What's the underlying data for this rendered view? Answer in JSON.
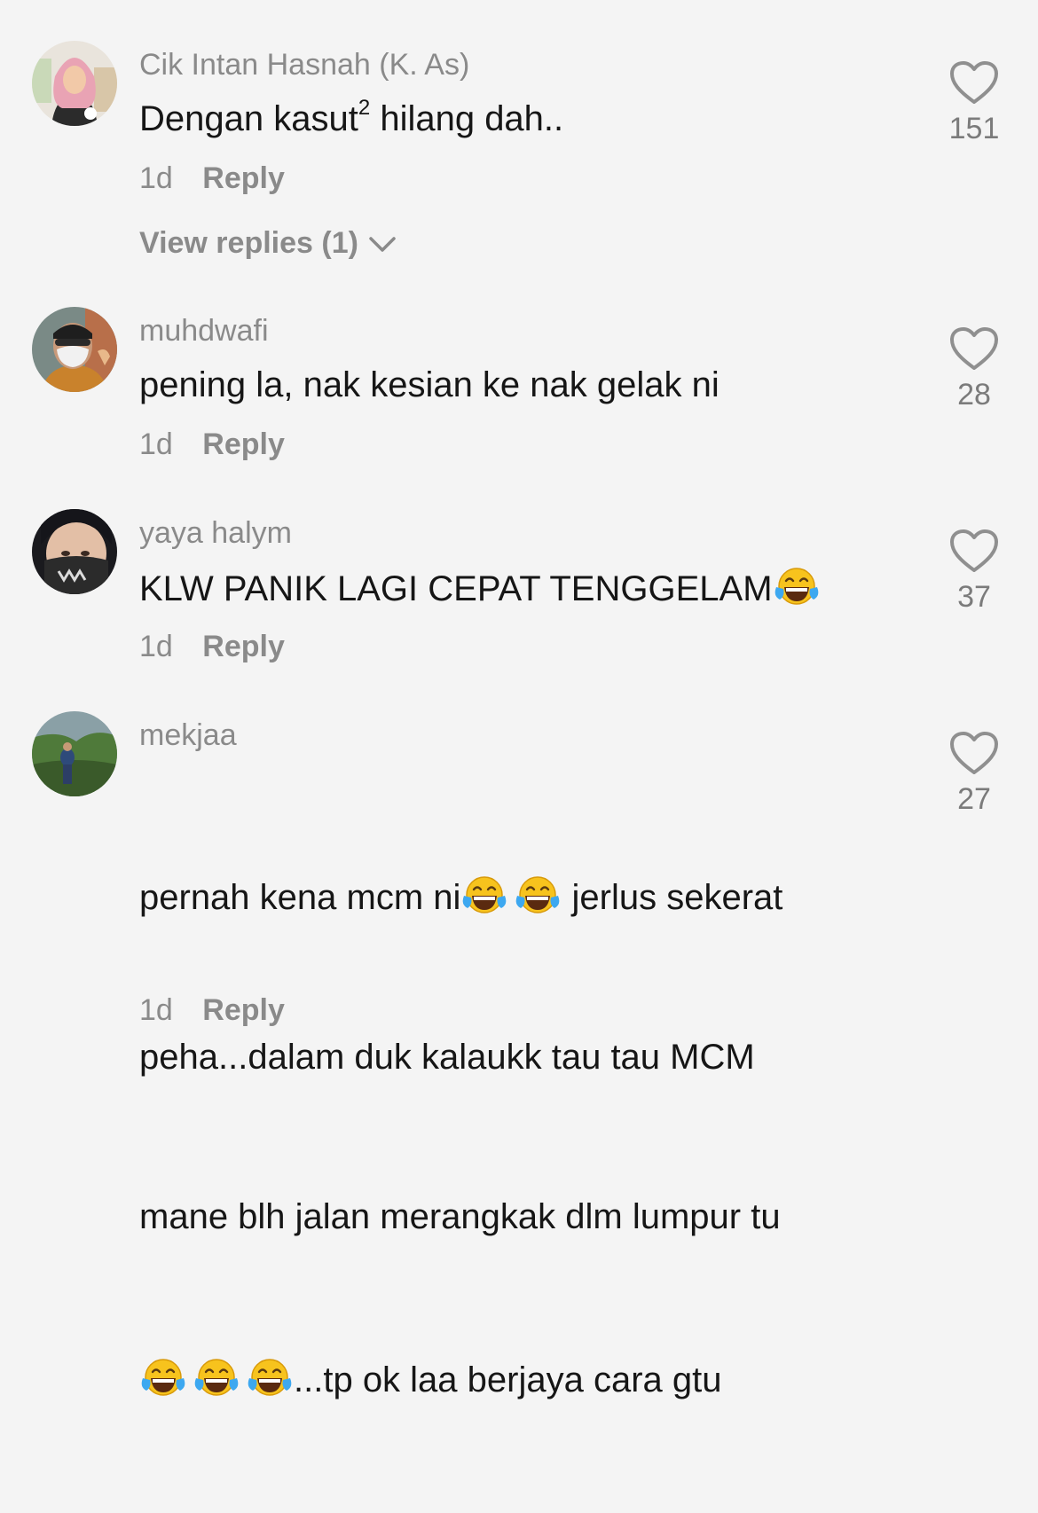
{
  "comments": [
    {
      "username": "Cik Intan Hasnah (K. As)",
      "text_before": "Dengan kasut",
      "text_sup": "2",
      "text_after": " hilang dah..",
      "age": "1d",
      "reply_label": "Reply",
      "view_replies_label": "View replies (1)",
      "likes": "151"
    },
    {
      "username": "muhdwafi",
      "text": "pening la, nak kesian ke nak gelak ni",
      "age": "1d",
      "reply_label": "Reply",
      "likes": "28"
    },
    {
      "username": "yaya halym",
      "text": "KLW PANIK LAGI CEPAT TENGGELAM",
      "age": "1d",
      "reply_label": "Reply",
      "likes": "37"
    },
    {
      "username": "mekjaa",
      "text_line1": "pernah kena mcm ni",
      "text_line1b": " jerlus sekerat",
      "text_line2": "peha...dalam duk kalaukk tau tau MCM",
      "text_line3": "mane blh jalan merangkak dlm lumpur tu",
      "text_line4": "...tp ok laa berjaya cara gtu",
      "age": "1d",
      "reply_label": "Reply",
      "likes": "27"
    }
  ],
  "icons": {
    "like": "heart-outline-icon",
    "expand": "chevron-down-icon",
    "emoji": "face-with-tears-of-joy-emoji"
  },
  "colors": {
    "background": "#f4f4f4",
    "text": "#161616",
    "muted": "#8a8a8a"
  }
}
